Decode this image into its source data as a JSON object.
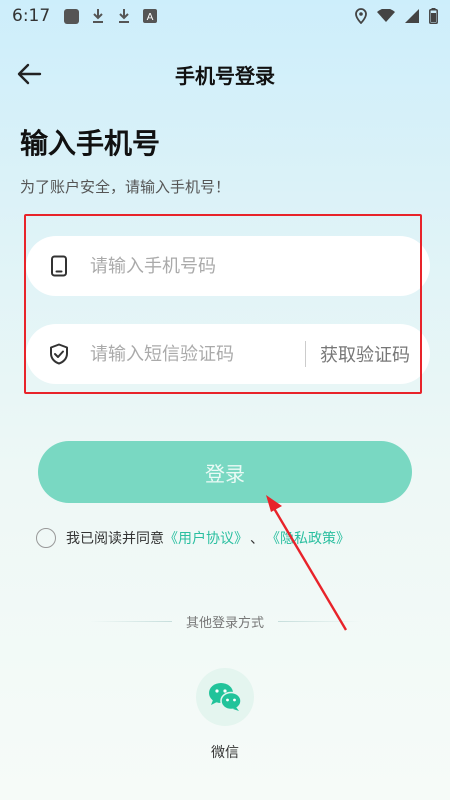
{
  "status_bar": {
    "time": "6:17",
    "icons": [
      "app-square-icon",
      "download-icon",
      "download-icon",
      "a-icon",
      "location-icon",
      "wifi-icon",
      "signal-icon",
      "battery-icon"
    ]
  },
  "header": {
    "title": "手机号登录",
    "back_icon": "arrow-left-icon"
  },
  "page": {
    "title": "输入手机号",
    "subtitle": "为了账户安全，请输入手机号！"
  },
  "phone_input": {
    "placeholder": "请输入手机号码",
    "value": "",
    "icon": "phone-icon"
  },
  "code_input": {
    "placeholder": "请输入短信验证码",
    "value": "",
    "icon": "shield-check-icon",
    "get_code_label": "获取验证码"
  },
  "login_button": {
    "label": "登录"
  },
  "agreement": {
    "prefix": "我已阅读并同意",
    "user_agreement": "《用户协议》",
    "separator": "、",
    "privacy_policy": "《隐私政策》",
    "checked": false
  },
  "other_login": {
    "label": "其他登录方式",
    "wechat_label": "微信",
    "wechat_icon": "wechat-icon"
  },
  "colors": {
    "accent": "#79d8c2",
    "link": "#2bbfa0",
    "highlight": "#e8232a"
  }
}
